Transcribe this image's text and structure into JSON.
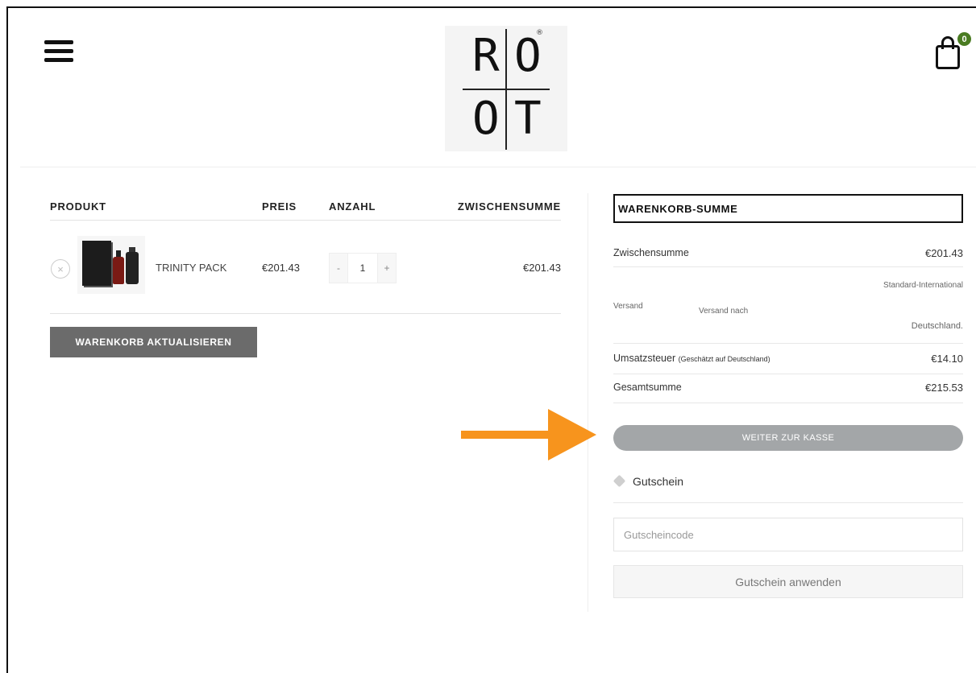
{
  "header": {
    "logo": {
      "letters": [
        "R",
        "O",
        "O",
        "T"
      ],
      "reg_mark": "®"
    },
    "cart_count": "0"
  },
  "cart_table": {
    "columns": [
      "PRODUKT",
      "PREIS",
      "ANZAHL",
      "ZWISCHENSUMME"
    ],
    "rows": [
      {
        "remove": "×",
        "name": "TRINITY PACK",
        "price": "€201.43",
        "qty_minus": "-",
        "qty": "1",
        "qty_plus": "+",
        "subtotal": "€201.43"
      }
    ],
    "update_label": "WARENKORB AKTUALISIEREN"
  },
  "totals": {
    "title": "WARENKORB-SUMME",
    "subtotal_label": "Zwischensumme",
    "subtotal_value": "€201.43",
    "shipping_label": "Versand",
    "shipping_method": "Standard-International",
    "shipping_to_label": "Versand nach",
    "shipping_to_value": "Deutschland.",
    "tax_label": "Umsatzsteuer",
    "tax_note": "(Geschätzt auf Deutschland)",
    "tax_value": "€14.10",
    "total_label": "Gesamtsumme",
    "total_value": "€215.53",
    "checkout_label": "WEITER ZUR KASSE"
  },
  "coupon": {
    "title": "Gutschein",
    "placeholder": "Gutscheincode",
    "apply_label": "Gutschein anwenden"
  },
  "colors": {
    "accent_arrow": "#f7941d",
    "badge": "#4a7c22",
    "button_dark": "#6b6b6b",
    "checkout": "#a3a6a8"
  }
}
